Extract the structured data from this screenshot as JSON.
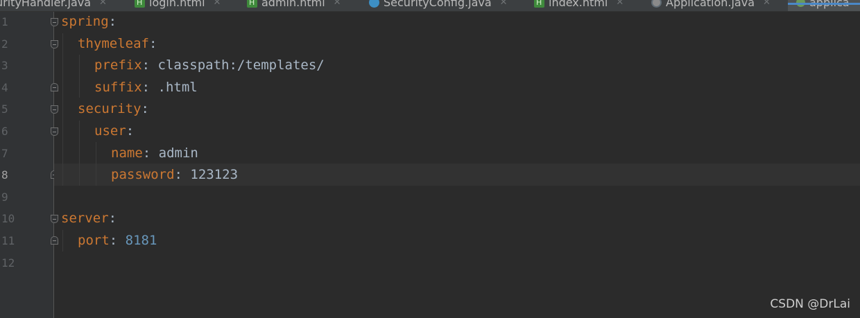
{
  "tabs": [
    {
      "label": "urityHandler.java",
      "icon": "java-icon",
      "active": false
    },
    {
      "label": "login.html",
      "icon": "html-file-icon",
      "active": false
    },
    {
      "label": "admin.html",
      "icon": "html-file-icon",
      "active": false
    },
    {
      "label": "SecurityConfig.java",
      "icon": "java-class-icon",
      "active": false
    },
    {
      "label": "index.html",
      "icon": "html-file-icon",
      "active": false
    },
    {
      "label": "Application.java",
      "icon": "spring-app-icon",
      "active": false
    },
    {
      "label": "applica",
      "icon": "yml-file-icon",
      "active": true
    }
  ],
  "current_line": 8,
  "lines": [
    {
      "n": "1",
      "key": "spring",
      "sep": ":",
      "value": ""
    },
    {
      "n": "2",
      "key": "thymeleaf",
      "sep": ":",
      "value": ""
    },
    {
      "n": "3",
      "key": "prefix",
      "sep": ": ",
      "value": "classpath:/templates/"
    },
    {
      "n": "4",
      "key": "suffix",
      "sep": ": ",
      "value": ".html"
    },
    {
      "n": "5",
      "key": "security",
      "sep": ":",
      "value": ""
    },
    {
      "n": "6",
      "key": "user",
      "sep": ":",
      "value": ""
    },
    {
      "n": "7",
      "key": "name",
      "sep": ": ",
      "value": "admin"
    },
    {
      "n": "8",
      "key": "password",
      "sep": ": ",
      "value": "123123"
    },
    {
      "n": "9",
      "key": "",
      "sep": "",
      "value": ""
    },
    {
      "n": "10",
      "key": "server",
      "sep": ":",
      "value": ""
    },
    {
      "n": "11",
      "key": "port",
      "sep": ": ",
      "value": "8181"
    },
    {
      "n": "12",
      "key": "",
      "sep": "",
      "value": ""
    }
  ],
  "watermark": "CSDN @DrLai",
  "colors": {
    "key": "#cc7832",
    "number": "#6897bb",
    "text": "#a9b7c6",
    "accent": "#4a88c7"
  }
}
